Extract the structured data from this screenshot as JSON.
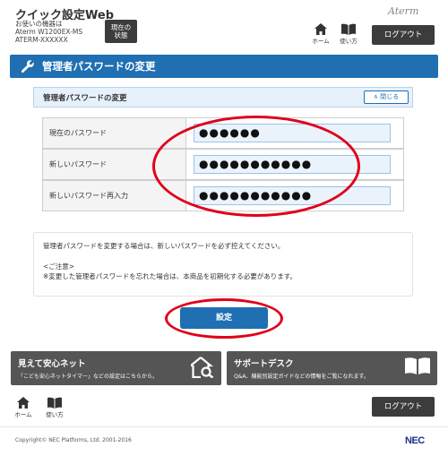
{
  "header": {
    "app_title": "クイック設定Web",
    "device_lines": [
      "お使いの機器は",
      "Aterm W1200EX-MS",
      "ATERM-XXXXXX"
    ],
    "status_button_lines": [
      "現在の",
      "状態"
    ],
    "brand": "Aterm",
    "home_label": "ホーム",
    "help_label": "使い方",
    "logout_label": "ログアウト"
  },
  "section": {
    "title": "管理者パスワードの変更",
    "icon": "wrench-icon"
  },
  "panel": {
    "title": "管理者パスワードの変更",
    "close_label": "閉じる",
    "rows": [
      {
        "label": "現在のパスワード",
        "value": "●●●●●●"
      },
      {
        "label": "新しいパスワード",
        "value": "●●●●●●●●●●●"
      },
      {
        "label": "新しいパスワード再入力",
        "value": "●●●●●●●●●●●"
      }
    ]
  },
  "notice": {
    "line1": "管理者パスワードを変更する場合は、新しいパスワードを必ず控えてください。",
    "line2": "<ご注意>",
    "line3": "※変更した管理者パスワードを忘れた場合は、本商品を初期化する必要があります。"
  },
  "submit_label": "設定",
  "promos": {
    "left": {
      "title": "見えて安心ネット",
      "desc": "「こども安心ネットタイマー」などの設定はこちらから。",
      "icon": "house-search-icon"
    },
    "right": {
      "title": "サポートデスク",
      "desc": "Q&A、機能別設定ガイドなどの情報をご覧になれます。",
      "icon": "book-icon"
    }
  },
  "footer": {
    "home_label": "ホーム",
    "help_label": "使い方",
    "logout_label": "ログアウト",
    "copyright": "Copyright© NEC Platforms, Ltd. 2001-2016",
    "logo": "NEC"
  },
  "colors": {
    "accent_blue": "#1f6fb2",
    "dark_button": "#3c3c3c",
    "annotation_red": "#e0001b"
  }
}
